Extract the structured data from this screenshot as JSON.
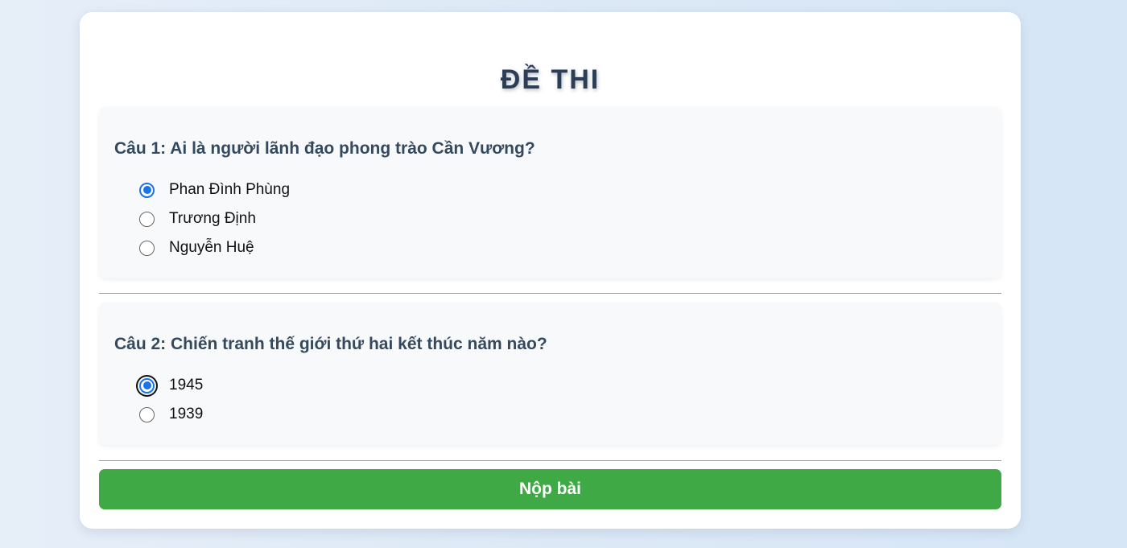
{
  "exam": {
    "title": "ĐỀ THI",
    "questions": [
      {
        "text": "Câu 1: Ai là người lãnh đạo phong trào Cần Vương?",
        "options": [
          {
            "label": "Phan Đình Phùng",
            "checked": true
          },
          {
            "label": "Trương Định",
            "checked": false
          },
          {
            "label": "Nguyễn Huệ",
            "checked": false
          }
        ]
      },
      {
        "text": "Câu 2: Chiến tranh thế giới thứ hai kết thúc năm nào?",
        "options": [
          {
            "label": "1945",
            "checked": true,
            "focused": true
          },
          {
            "label": "1939",
            "checked": false
          }
        ]
      }
    ],
    "submit_label": "Nộp bài"
  },
  "colors": {
    "accent_blue": "#1a73e8",
    "submit_green": "#3fa945",
    "title_color": "#2c3e55",
    "question_color": "#34495e"
  }
}
